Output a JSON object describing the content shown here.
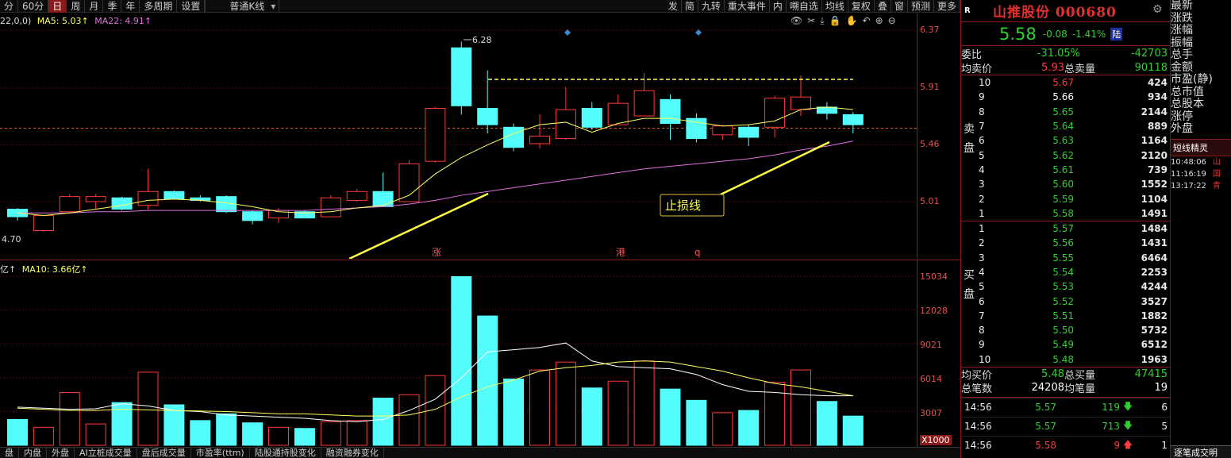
{
  "toolbar": {
    "periods": [
      "分",
      "60分",
      "日",
      "周",
      "月",
      "季",
      "年",
      "多周期",
      "设置"
    ],
    "active_period": "日",
    "kline_type": "普通K线",
    "right_items": [
      "发",
      "简",
      "九转",
      "重大事件",
      "内",
      "嗍自选",
      "均线",
      "复权",
      "叠",
      "窗",
      "预测",
      "更多"
    ]
  },
  "price_legend": {
    "prefix": "22,0,0)",
    "ma5": "MA5: 5.03↑",
    "ma22": "MA22: 4.91↑"
  },
  "volume_legend": {
    "prefix": "亿↑",
    "ma10": "MA10: 3.66亿↑"
  },
  "price_axis_ticks": [
    "6.37",
    "5.91",
    "5.46",
    "5.01"
  ],
  "volume_axis_ticks": [
    "15034",
    "12028",
    "9021",
    "6014",
    "3007"
  ],
  "volume_axis_unit": "X1000",
  "annotations": {
    "high": "6.28",
    "low": "4.70",
    "stop_loss": "止损线",
    "markers": [
      "涨",
      "港",
      "q"
    ]
  },
  "chart_data": {
    "type": "candlestick",
    "ylim": [
      4.7,
      6.37
    ],
    "candles": [
      {
        "o": 4.95,
        "c": 4.89,
        "h": 4.96,
        "l": 4.86,
        "v": 2300,
        "up": false
      },
      {
        "o": 4.78,
        "c": 4.9,
        "h": 4.9,
        "l": 4.77,
        "v": 1600,
        "up": true
      },
      {
        "o": 4.93,
        "c": 5.05,
        "h": 5.07,
        "l": 4.92,
        "v": 4700,
        "up": true
      },
      {
        "o": 5.01,
        "c": 5.05,
        "h": 5.07,
        "l": 4.95,
        "v": 1900,
        "up": true
      },
      {
        "o": 5.04,
        "c": 4.95,
        "h": 5.05,
        "l": 4.94,
        "v": 3800,
        "up": false
      },
      {
        "o": 4.98,
        "c": 5.09,
        "h": 5.27,
        "l": 4.95,
        "v": 6500,
        "up": true
      },
      {
        "o": 5.09,
        "c": 5.03,
        "h": 5.1,
        "l": 5.03,
        "v": 3600,
        "up": false
      },
      {
        "o": 5.04,
        "c": 5.02,
        "h": 5.06,
        "l": 5.01,
        "v": 2200,
        "up": false
      },
      {
        "o": 5.05,
        "c": 4.93,
        "h": 5.06,
        "l": 4.92,
        "v": 2800,
        "up": false
      },
      {
        "o": 4.93,
        "c": 4.86,
        "h": 4.94,
        "l": 4.83,
        "v": 2000,
        "up": false
      },
      {
        "o": 4.88,
        "c": 4.94,
        "h": 4.96,
        "l": 4.84,
        "v": 1600,
        "up": true
      },
      {
        "o": 4.93,
        "c": 4.88,
        "h": 4.94,
        "l": 4.88,
        "v": 1500,
        "up": false
      },
      {
        "o": 4.89,
        "c": 5.04,
        "h": 5.06,
        "l": 4.89,
        "v": 2100,
        "up": true
      },
      {
        "o": 5.02,
        "c": 5.09,
        "h": 5.11,
        "l": 5.01,
        "v": 2200,
        "up": true
      },
      {
        "o": 5.09,
        "c": 4.97,
        "h": 5.24,
        "l": 4.97,
        "v": 4200,
        "up": false
      },
      {
        "o": 5.01,
        "c": 5.31,
        "h": 5.34,
        "l": 5.01,
        "v": 4500,
        "up": true
      },
      {
        "o": 5.33,
        "c": 5.75,
        "h": 5.76,
        "l": 5.32,
        "v": 6200,
        "up": true
      },
      {
        "o": 6.23,
        "c": 5.77,
        "h": 6.28,
        "l": 5.7,
        "v": 15000,
        "up": false
      },
      {
        "o": 5.75,
        "c": 5.62,
        "h": 6.05,
        "l": 5.55,
        "v": 11500,
        "up": false
      },
      {
        "o": 5.6,
        "c": 5.44,
        "h": 5.63,
        "l": 5.41,
        "v": 5900,
        "up": false
      },
      {
        "o": 5.47,
        "c": 5.53,
        "h": 5.7,
        "l": 5.43,
        "v": 6700,
        "up": true
      },
      {
        "o": 5.51,
        "c": 5.74,
        "h": 5.92,
        "l": 5.5,
        "v": 7400,
        "up": true
      },
      {
        "o": 5.75,
        "c": 5.6,
        "h": 5.8,
        "l": 5.58,
        "v": 5100,
        "up": false
      },
      {
        "o": 5.62,
        "c": 5.79,
        "h": 5.86,
        "l": 5.62,
        "v": 5700,
        "up": true
      },
      {
        "o": 5.69,
        "c": 5.89,
        "h": 6.03,
        "l": 5.69,
        "v": 7500,
        "up": true
      },
      {
        "o": 5.82,
        "c": 5.63,
        "h": 5.86,
        "l": 5.5,
        "v": 5000,
        "up": false
      },
      {
        "o": 5.67,
        "c": 5.51,
        "h": 5.71,
        "l": 5.48,
        "v": 4000,
        "up": false
      },
      {
        "o": 5.54,
        "c": 5.61,
        "h": 5.62,
        "l": 5.5,
        "v": 2900,
        "up": true
      },
      {
        "o": 5.6,
        "c": 5.52,
        "h": 5.62,
        "l": 5.45,
        "v": 3100,
        "up": false
      },
      {
        "o": 5.6,
        "c": 5.83,
        "h": 5.85,
        "l": 5.52,
        "v": 5600,
        "up": true
      },
      {
        "o": 5.74,
        "c": 5.84,
        "h": 6.01,
        "l": 5.69,
        "v": 6700,
        "up": true
      },
      {
        "o": 5.76,
        "c": 5.71,
        "h": 5.8,
        "l": 5.66,
        "v": 3900,
        "up": false
      },
      {
        "o": 5.7,
        "c": 5.62,
        "h": 5.72,
        "l": 5.55,
        "v": 2600,
        "up": false
      }
    ],
    "ma5": [
      4.92,
      4.9,
      4.92,
      4.95,
      4.98,
      5.02,
      5.03,
      5.02,
      5.0,
      4.97,
      4.93,
      4.92,
      4.93,
      4.96,
      4.98,
      5.06,
      5.23,
      5.36,
      5.46,
      5.55,
      5.62,
      5.64,
      5.56,
      5.63,
      5.67,
      5.67,
      5.64,
      5.61,
      5.62,
      5.65,
      5.74,
      5.76,
      5.74
    ],
    "ma22": [
      4.92,
      4.92,
      4.92,
      4.93,
      4.93,
      4.94,
      4.94,
      4.94,
      4.94,
      4.94,
      4.94,
      4.94,
      4.95,
      4.96,
      4.97,
      4.99,
      5.02,
      5.06,
      5.09,
      5.12,
      5.15,
      5.18,
      5.21,
      5.24,
      5.27,
      5.29,
      5.31,
      5.33,
      5.35,
      5.38,
      5.42,
      5.45,
      5.49
    ],
    "vol_ma5": [
      3400,
      3300,
      3200,
      3250,
      3700,
      3500,
      3100,
      3000,
      2700,
      2600,
      2500,
      2400,
      2200,
      2100,
      2300,
      3100,
      4100,
      6000,
      8300,
      8500,
      8700,
      9100,
      7500,
      7000,
      6900,
      6800,
      6300,
      5400,
      4800,
      4700,
      4500,
      4400,
      4400
    ],
    "vol_ma10": [
      3300,
      3200,
      3100,
      3100,
      3200,
      3150,
      3100,
      3050,
      3000,
      2900,
      2800,
      2800,
      2700,
      2600,
      2600,
      2700,
      3200,
      4300,
      5200,
      5800,
      6600,
      6900,
      7100,
      7400,
      7500,
      7400,
      7000,
      6600,
      6000,
      5500,
      5200,
      4800,
      4400
    ],
    "vol_ylim": [
      0,
      16000
    ],
    "colors": {
      "up": "#ff3b3b",
      "down": "#54fcfc",
      "ma5": "#ffff60",
      "ma22": "#e070e0",
      "vol_ma": "#ffffff"
    }
  },
  "panel": {
    "flag": "R",
    "title": "山推股份 000680",
    "price": "5.58",
    "change": "-0.08",
    "change_pct": "-1.41%",
    "board": "陆",
    "weibi_label": "委比",
    "weibi_pct": "-31.05%",
    "weibi_diff": "-42703",
    "avg_sell_label": "均卖价",
    "avg_sell": "5.93",
    "total_sell_label": "总卖量",
    "total_sell": "90118",
    "sell_label_1": "卖",
    "sell_label_2": "盘",
    "sell_levels": [
      {
        "n": "10",
        "p": "5.67",
        "v": "424",
        "c": "red"
      },
      {
        "n": "9",
        "p": "5.66",
        "v": "934",
        "c": "white"
      },
      {
        "n": "8",
        "p": "5.65",
        "v": "2144",
        "c": "green"
      },
      {
        "n": "7",
        "p": "5.64",
        "v": "889",
        "c": "green"
      },
      {
        "n": "6",
        "p": "5.63",
        "v": "1164",
        "c": "green"
      },
      {
        "n": "5",
        "p": "5.62",
        "v": "2120",
        "c": "green"
      },
      {
        "n": "4",
        "p": "5.61",
        "v": "739",
        "c": "green"
      },
      {
        "n": "3",
        "p": "5.60",
        "v": "1552",
        "c": "green"
      },
      {
        "n": "2",
        "p": "5.59",
        "v": "1104",
        "c": "green"
      },
      {
        "n": "1",
        "p": "5.58",
        "v": "1491",
        "c": "green"
      }
    ],
    "buy_label_1": "买",
    "buy_label_2": "盘",
    "buy_levels": [
      {
        "n": "1",
        "p": "5.57",
        "v": "1484",
        "c": "green"
      },
      {
        "n": "2",
        "p": "5.56",
        "v": "1431",
        "c": "green"
      },
      {
        "n": "3",
        "p": "5.55",
        "v": "6464",
        "c": "green"
      },
      {
        "n": "4",
        "p": "5.54",
        "v": "2253",
        "c": "green"
      },
      {
        "n": "5",
        "p": "5.53",
        "v": "4244",
        "c": "green"
      },
      {
        "n": "6",
        "p": "5.52",
        "v": "3527",
        "c": "green"
      },
      {
        "n": "7",
        "p": "5.51",
        "v": "1882",
        "c": "green"
      },
      {
        "n": "8",
        "p": "5.50",
        "v": "5732",
        "c": "green"
      },
      {
        "n": "9",
        "p": "5.49",
        "v": "6512",
        "c": "green"
      },
      {
        "n": "10",
        "p": "5.48",
        "v": "1963",
        "c": "green"
      }
    ],
    "avg_buy_label": "均买价",
    "avg_buy": "5.48",
    "total_buy_label": "总买量",
    "total_buy": "47415",
    "total_trades_label": "总笔数",
    "total_trades": "24208",
    "avg_trade_label": "均笔量",
    "avg_trade": "19",
    "ticks": [
      {
        "t": "14:56",
        "p": "5.57",
        "v": "119",
        "dir": "down",
        "c": "6"
      },
      {
        "t": "14:56",
        "p": "5.57",
        "v": "713",
        "dir": "down",
        "c": "5"
      },
      {
        "t": "14:56",
        "p": "5.58",
        "v": "9",
        "dir": "up",
        "c": "1"
      }
    ]
  },
  "side": {
    "labels": [
      "最新",
      "涨跌",
      "涨幅",
      "振幅",
      "总手",
      "金额",
      "市盈(静)",
      "总市值",
      "总股本",
      "涨停",
      "外盘"
    ],
    "title": "短线精灵",
    "items": [
      {
        "time": "10:48:06",
        "tag": "山"
      },
      {
        "time": "11:16:19",
        "tag": "国"
      },
      {
        "time": "13:17:22",
        "tag": "青"
      }
    ],
    "footer": "逐笔成交明"
  },
  "bottom_tabs": [
    "盘",
    "内盘",
    "外盘",
    "AI立桩成交量",
    "盘后成交量",
    "市盈率(ttm)",
    "陆股通持股变化",
    "融资融券变化"
  ]
}
